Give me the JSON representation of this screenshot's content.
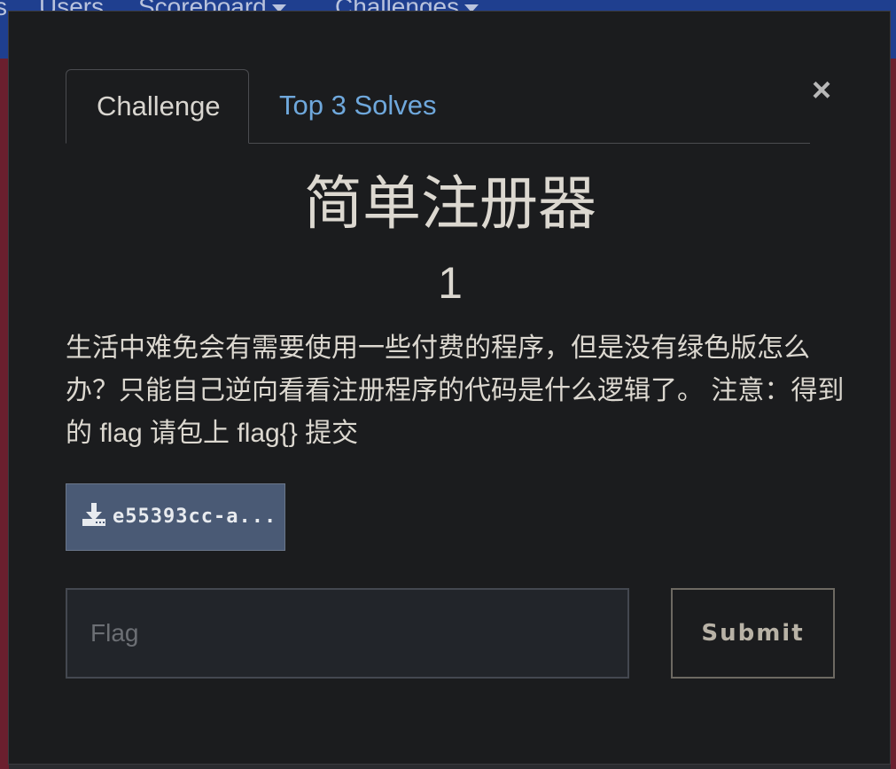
{
  "navbar": {
    "items": [
      {
        "label": "s"
      },
      {
        "label": "Users"
      },
      {
        "label": "Scoreboard"
      },
      {
        "label": "Challenges"
      }
    ]
  },
  "modal": {
    "tabs": [
      {
        "label": "Challenge"
      },
      {
        "label": "Top 3 Solves"
      }
    ],
    "close_label": "×",
    "title": "简单注册器",
    "points": "1",
    "description": "生活中难免会有需要使用一些付费的程序，但是没有绿色版怎么办？只能自己逆向看看注册程序的代码是什么逻辑了。 注意：得到的 flag 请包上 flag{} 提交",
    "download": {
      "label": "e55393cc-a...",
      "icon": "download-icon"
    },
    "flag_input": {
      "value": "",
      "placeholder": "Flag"
    },
    "submit_label": "Submit"
  },
  "colors": {
    "modal_bg": "#1b1c1e",
    "tab_link": "#6fa8dc",
    "download_bg": "#4a5a75",
    "navbar_bg": "#1f3f8f"
  }
}
